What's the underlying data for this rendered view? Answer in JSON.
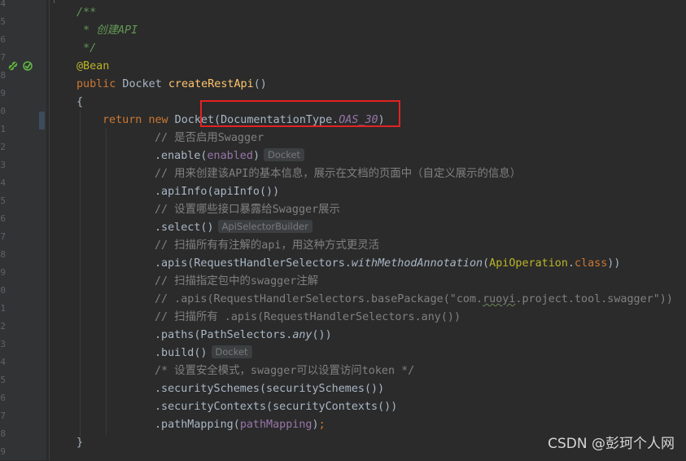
{
  "gutter": {
    "line_numbers": [
      "4",
      "5",
      "6",
      "7",
      "8",
      "9",
      "0",
      "1",
      "2",
      "3",
      "4",
      "5",
      "6",
      "7",
      "8",
      "9",
      "0",
      "1",
      "2",
      "3",
      "4",
      "5",
      "6",
      "7",
      "8",
      "9"
    ]
  },
  "code": {
    "l1": "/**",
    "l2": " * 创建API",
    "l3": " */",
    "l4": "@Bean",
    "l5_kw": "public",
    "l5_type": " Docket ",
    "l5_fn": "createRestApi",
    "l5_paren": "()",
    "l6": "{",
    "l7_kw1": "return",
    "l7_sp": " ",
    "l7_kw2": "new",
    "l7_rest": " Docket(DocumentationType.",
    "l7_field": "OAS_30",
    "l7_end": ")",
    "l8": "// 是否启用Swagger",
    "l9_a": ".enable(",
    "l9_field": "enabled",
    "l9_b": ")",
    "l9_hint": "Docket",
    "l10": "// 用来创建该API的基本信息，展示在文档的页面中（自定义展示的信息）",
    "l11": ".apiInfo(apiInfo())",
    "l12": "// 设置哪些接口暴露给Swagger展示",
    "l13_a": ".select()",
    "l13_hint": "ApiSelectorBuilder",
    "l14": "// 扫描所有有注解的api，用这种方式更灵活",
    "l15_a": ".apis(RequestHandlerSelectors.",
    "l15_it": "withMethodAnnotation",
    "l15_b": "(",
    "l15_an": "ApiOperation",
    "l15_c": ".",
    "l15_kw": "class",
    "l15_d": "))",
    "l16": "// 扫描指定包中的swagger注解",
    "l17_a": "// .apis(RequestHandlerSelectors.basePackage(\"com.",
    "l17_sq": "ruoyi",
    "l17_b": ".project.tool.swagger\"))",
    "l18": "// 扫描所有 .apis(RequestHandlerSelectors.any())",
    "l19_a": ".paths(PathSelectors.",
    "l19_it": "any",
    "l19_b": "())",
    "l20_a": ".build()",
    "l20_hint": "Docket",
    "l21": "/* 设置安全模式，swagger可以设置访问token */",
    "l22": ".securitySchemes(securitySchemes())",
    "l23": ".securityContexts(securityContexts())",
    "l24_a": ".pathMapping(",
    "l24_field": "pathMapping",
    "l24_b": ")",
    "l24_semi": ";",
    "l25": "}"
  },
  "watermark": "CSDN @彭珂个人网",
  "colors": {
    "background": "#2b2b2b",
    "keyword": "#cc7832",
    "function": "#ffc66d",
    "annotation": "#bbb529",
    "doc_comment": "#629755",
    "comment": "#808080",
    "field": "#9876aa",
    "highlight_box": "#e32222"
  }
}
